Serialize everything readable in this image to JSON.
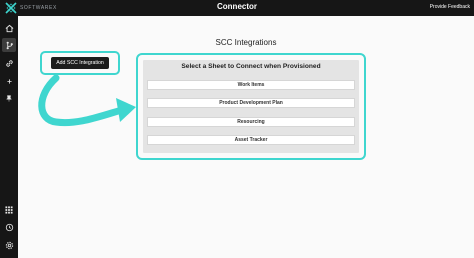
{
  "topbar": {
    "brand": "SOFTWAREX",
    "title": "Connector",
    "feedback_link": "Provide Feedback"
  },
  "sidebar": {
    "items": [
      {
        "name": "home",
        "icon": "home-icon",
        "active": false
      },
      {
        "name": "connector",
        "icon": "connector-icon",
        "active": true
      },
      {
        "name": "link",
        "icon": "link-icon",
        "active": false
      },
      {
        "name": "add",
        "icon": "plus-icon",
        "active": false
      },
      {
        "name": "pin",
        "icon": "pin-icon",
        "active": false
      },
      {
        "name": "apps",
        "icon": "grid-icon",
        "active": false
      },
      {
        "name": "history",
        "icon": "history-icon",
        "active": false
      },
      {
        "name": "settings",
        "icon": "gear-icon",
        "active": false
      }
    ]
  },
  "main": {
    "title": "SCC Integrations",
    "add_button": "Add SCC Integration",
    "panel": {
      "heading": "Select a Sheet to Connect when Provisioned",
      "sheets": [
        "Work Items",
        "Product Development Plan",
        "Resourcing",
        "Asset Tracker"
      ]
    }
  },
  "colors": {
    "accent": "#3fd6cf",
    "topbar": "#161616",
    "button": "#1c1c1c"
  }
}
